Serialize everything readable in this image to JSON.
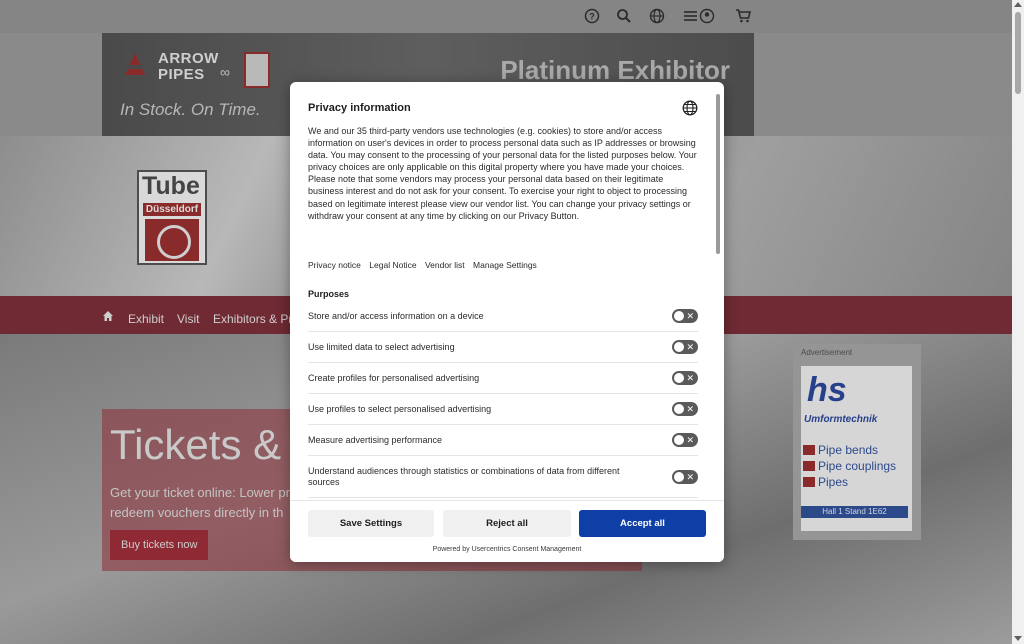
{
  "topbar": {
    "icons": [
      "help-icon",
      "search-icon",
      "globe-icon",
      "menu-account-icon",
      "cart-icon"
    ]
  },
  "ad_banner": {
    "brand_line1": "ARROW",
    "brand_line2": "PIPES",
    "slogan": "In Stock. On Time.",
    "badge": "Platinum Exhibitor"
  },
  "hero": {
    "logo_word": "Tube",
    "logo_city": "Düsseldorf"
  },
  "nav": {
    "items": [
      "Exhibit",
      "Visit",
      "Exhibitors & Pr"
    ]
  },
  "tickets": {
    "title": "Tickets &",
    "text": "Get your ticket online: Lower pr redeem vouchers directly in th",
    "button": "Buy tickets now"
  },
  "side_ad": {
    "label": "Advertisement",
    "logo": "hs",
    "company": "Umformtechnik",
    "items": [
      "Pipe bends",
      "Pipe couplings",
      "Pipes"
    ],
    "hall": "Hall 1 Stand 1E62"
  },
  "consent": {
    "title": "Privacy information",
    "body": "We and our 35 third-party vendors use technologies (e.g. cookies) to store and/or access information on user's devices in order to process personal data such as IP addresses or browsing data. You may consent to the processing of your personal data for the listed purposes below. Your privacy choices are only applicable on this digital property where you have made your choices. Please note that some vendors may process your personal data based on their legitimate business interest and do not ask for your consent. To exercise your right to object to processing based on legitimate interest please view our vendor list. You can change your privacy settings or withdraw your consent at any time by clicking on our Privacy Button.",
    "links": [
      "Privacy notice",
      "Legal Notice",
      "Vendor list",
      "Manage Settings"
    ],
    "purposes_heading": "Purposes",
    "purposes": [
      "Store and/or access information on a device",
      "Use limited data to select advertising",
      "Create profiles for personalised advertising",
      "Use profiles to select personalised advertising",
      "Measure advertising performance",
      "Understand audiences through statistics or combinations of data from different sources"
    ],
    "buttons": {
      "save": "Save Settings",
      "reject": "Reject all",
      "accept": "Accept all"
    },
    "powered_by": "Powered by Usercentrics Consent Management",
    "accent_color": "#0d3fa7"
  }
}
